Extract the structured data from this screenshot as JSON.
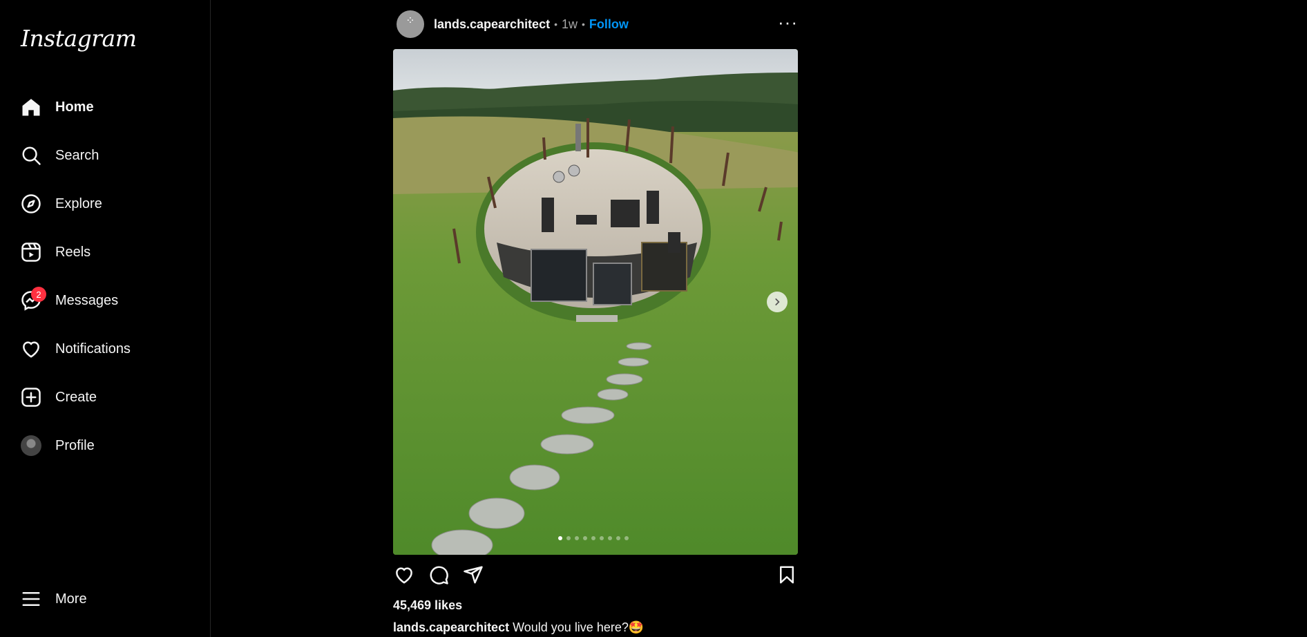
{
  "app": {
    "logo_text": "Instagram"
  },
  "sidebar": {
    "items": [
      {
        "label": "Home",
        "icon": "home-icon",
        "bold": true
      },
      {
        "label": "Search",
        "icon": "search-icon"
      },
      {
        "label": "Explore",
        "icon": "compass-icon"
      },
      {
        "label": "Reels",
        "icon": "reels-icon"
      },
      {
        "label": "Messages",
        "icon": "messenger-icon",
        "badge": "2"
      },
      {
        "label": "Notifications",
        "icon": "heart-icon"
      },
      {
        "label": "Create",
        "icon": "plus-square-icon"
      },
      {
        "label": "Profile",
        "icon": "avatar"
      }
    ],
    "more_label": "More"
  },
  "post": {
    "username": "lands.capearchitect",
    "time": "1w",
    "follow_label": "Follow",
    "image_count": 9,
    "active_index": 0,
    "likes": "45,469 likes",
    "caption_user": "lands.capearchitect",
    "caption_text": "Would you live here?🤩"
  },
  "colors": {
    "background": "#000000",
    "accent": "#0095f6",
    "badge": "#ff3040",
    "text": "#f5f5f5",
    "muted": "#a8a8a8"
  }
}
